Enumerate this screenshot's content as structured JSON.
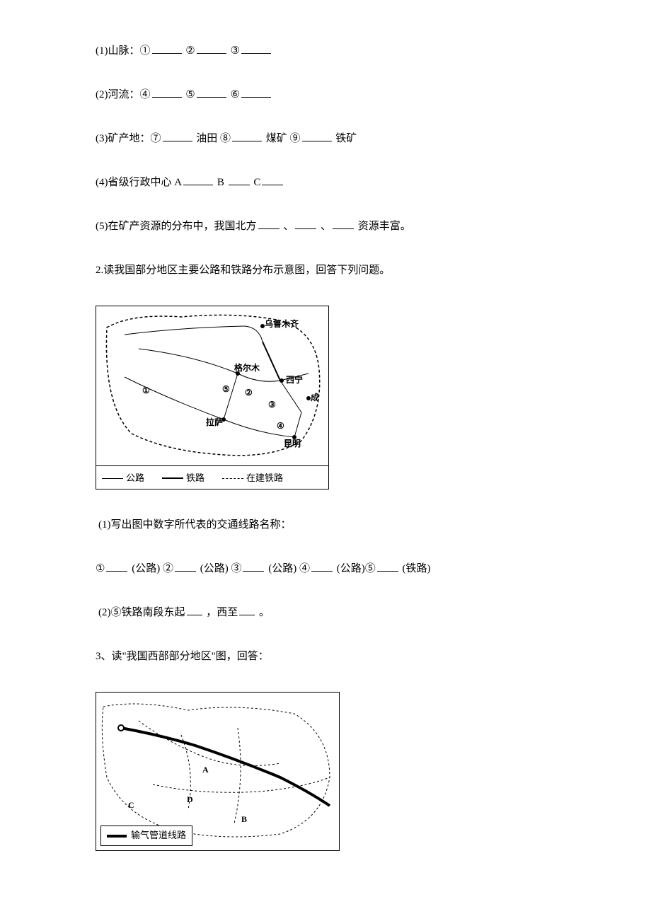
{
  "q1": {
    "line1_prefix": "(1)山脉：①",
    "line1_mid1": " ②",
    "line1_mid2": " ③",
    "line2_prefix": "(2)河流：④",
    "line2_mid1": "⑤",
    "line2_mid2": "⑥",
    "line3_prefix": "(3)矿产地：⑦",
    "line3_mid1": "油田  ⑧",
    "line3_mid2": "煤矿  ⑨",
    "line3_suffix": "铁矿",
    "line4_prefix": "(4)省级行政中心 A",
    "line4_mid1": "B ",
    "line4_mid2": "C",
    "line5_prefix": "(5)在矿产资源的分布中，我国北方",
    "line5_mid1": " 、",
    "line5_mid2": " 、",
    "line5_suffix": " 资源丰富。"
  },
  "q2": {
    "intro": "2.读我国部分地区主要公路和铁路分布示意图，回答下列问题。",
    "sub1_prefix": " (1)写出图中数字所代表的交通线路名称：",
    "sub1_line_1": "  ①",
    "sub1_r1": " (公路) ②",
    "sub1_r2": " (公路) ③",
    "sub1_r3": " (公路) ④",
    "sub1_r4": " (公路)⑤",
    "sub1_r5": " (铁路)",
    "sub2_prefix": " (2)⑤铁路南段东起",
    "sub2_mid": " ，西至",
    "sub2_suffix": " 。"
  },
  "q3": {
    "intro": "3、读\"我国西部部分地区\"图，回答："
  },
  "map1_labels": {
    "urumqi": "乌鲁木齐",
    "golmud": "格尔木",
    "xining": "西宁",
    "lhasa": "拉萨",
    "chengdu": "成",
    "kunming": "昆明",
    "n1": "①",
    "n2": "②",
    "n3": "③",
    "n4": "④",
    "n5": "⑤",
    "legend_road": "公路",
    "legend_rail": "铁路",
    "legend_building": "在建铁路"
  },
  "map2_labels": {
    "A": "A",
    "B": "B",
    "C": "C",
    "D": "D",
    "legend": "输气管道线路"
  }
}
